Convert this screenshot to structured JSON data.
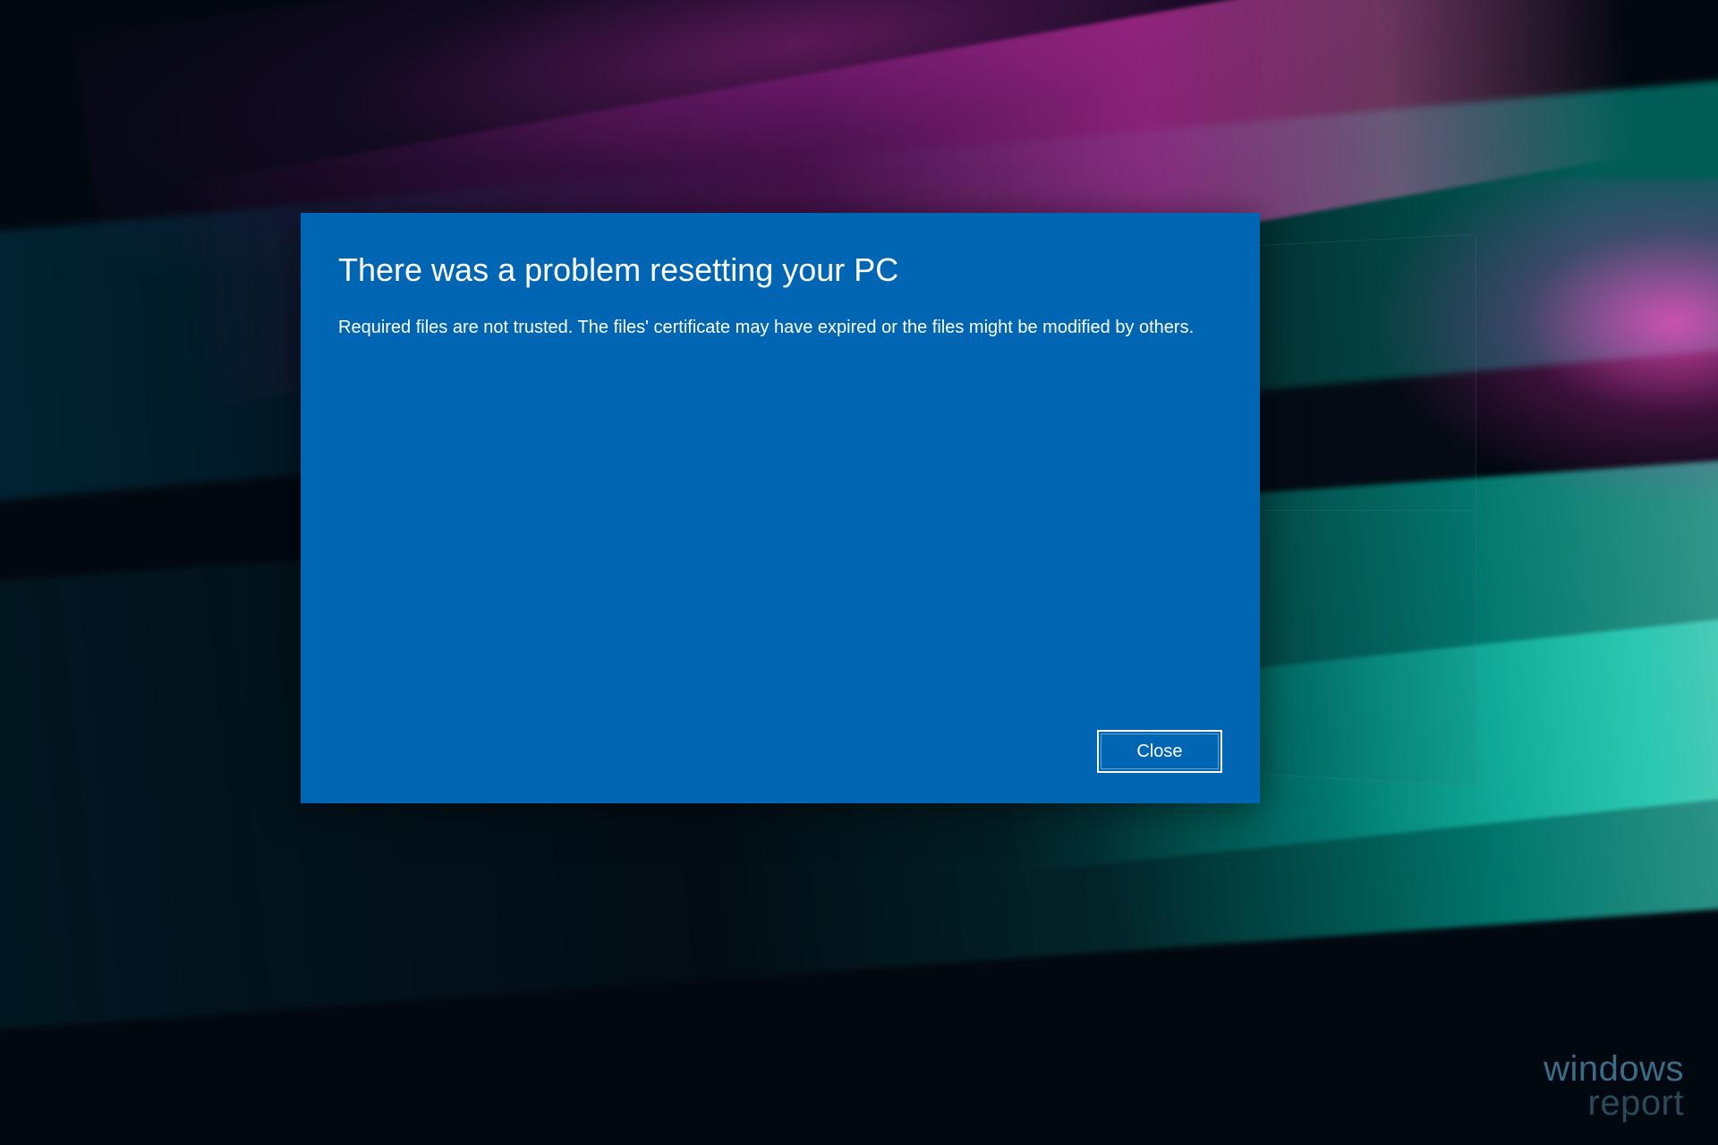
{
  "dialog": {
    "title": "There was a problem resetting your PC",
    "message": "Required files are not trusted. The files' certificate may have expired or the files might be modified by others.",
    "close_label": "Close"
  },
  "watermark": {
    "line1": "windows",
    "line2": "report"
  },
  "colors": {
    "dialog_bg": "#0066b3",
    "text": "#ffffff"
  }
}
